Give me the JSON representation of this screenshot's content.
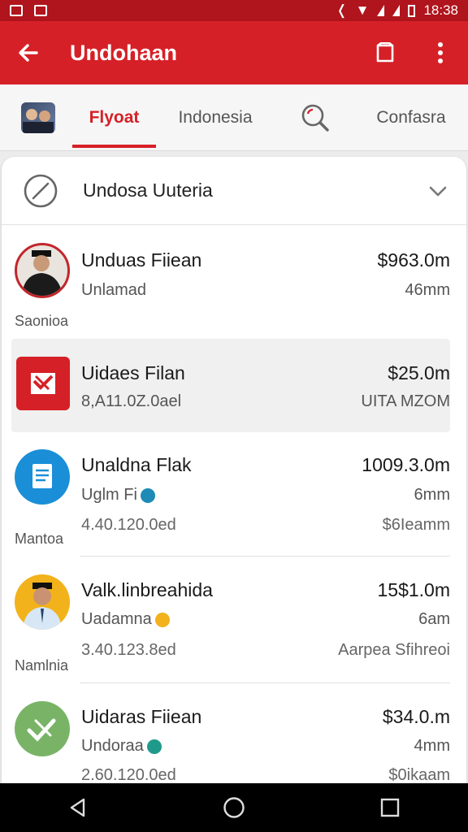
{
  "status_bar": {
    "time": "18:38"
  },
  "app_bar": {
    "title": "Undohaan"
  },
  "tabs": [
    {
      "label": "Flyoat"
    },
    {
      "label": "Indonesia"
    },
    {
      "label": "Confasra"
    }
  ],
  "filter": {
    "label": "Undosa Uuteria"
  },
  "items": [
    {
      "name": "Unduas Fiiean",
      "sub": "Unlamad",
      "side": "Saonioa",
      "amount": "$963.0m",
      "amount_sub": "46mm"
    },
    {
      "name": "Uidaes Filan",
      "sub": "8,A11.0Z.0ael",
      "amount": "$25.0m",
      "amount_sub": "UITA MZOM"
    },
    {
      "name": "Unaldna Flak",
      "sub": "Uglm Fi",
      "sub2": "4.40.120.0ed",
      "side": "Mantoa",
      "amount": "1009.3.0m",
      "amount_sub": "6mm",
      "amount_sub2": "$6Ieamm"
    },
    {
      "name": "Valk.linbreahida",
      "sub": "Uadamna",
      "sub2": "3.40.123.8ed",
      "side": "Namlnia",
      "amount": "15$1.0m",
      "amount_sub": "6am",
      "amount_sub2": "Aarpea Sfihreoi"
    },
    {
      "name": "Uidaras Fiiean",
      "sub": "Undoraa",
      "sub2": "2.60.120.0ed",
      "amount": "$34.0.m",
      "amount_sub": "4mm",
      "amount_sub2": "$0ikaam"
    }
  ],
  "colors": {
    "brand_red": "#d62027",
    "status_red": "#b0141c",
    "accent_blue": "#1a8fd8",
    "accent_green": "#79b466",
    "accent_gold": "#f2b21b"
  }
}
